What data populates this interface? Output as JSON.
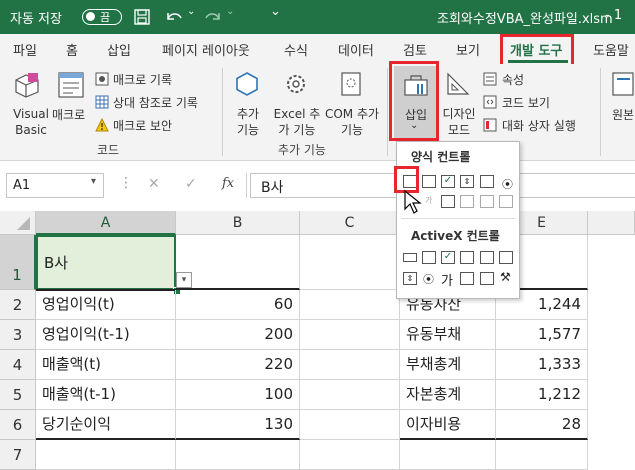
{
  "titlebar": {
    "autosave_label": "자동 저장",
    "toggle_state": "끔",
    "filename": "조회와수정VBA_완성파일.xlsm",
    "suffix": "- 1"
  },
  "tabs": [
    "파일",
    "홈",
    "삽입",
    "페이지 레이아웃",
    "수식",
    "데이터",
    "검토",
    "보기",
    "개발 도구",
    "도움말"
  ],
  "ribbon": {
    "code": {
      "visual_basic": "Visual Basic",
      "macro": "매크로",
      "record_macro": "매크로 기록",
      "relative_ref": "상대 참조로 기록",
      "macro_security": "매크로 보안",
      "group_label": "코드"
    },
    "addins": {
      "addins": "추가 기능",
      "excel_addins": "Excel 추가 기능",
      "com_addins": "COM 추가 기능",
      "group_label": "추가 기능"
    },
    "controls": {
      "insert": "삽입",
      "design_mode": "디자인 모드",
      "properties": "속성",
      "view_code": "코드 보기",
      "run_dialog": "대화 상자 실행"
    },
    "xml": {
      "source": "원본"
    }
  },
  "formula_bar": {
    "name_box": "A1",
    "fx": "fx",
    "value": "B사"
  },
  "columns": [
    "A",
    "B",
    "C",
    "D",
    "E"
  ],
  "rows": [
    {
      "num": "1",
      "a": "B사",
      "b": "",
      "d": "",
      "e": ""
    },
    {
      "num": "2",
      "a": "영업이익(t)",
      "b": "60",
      "d": "유동자산",
      "e": "1,244"
    },
    {
      "num": "3",
      "a": "영업이익(t-1)",
      "b": "200",
      "d": "유동부채",
      "e": "1,577"
    },
    {
      "num": "4",
      "a": "매출액(t)",
      "b": "220",
      "d": "부채총계",
      "e": "1,333"
    },
    {
      "num": "5",
      "a": "매출액(t-1)",
      "b": "100",
      "d": "자본총계",
      "e": "1,212"
    },
    {
      "num": "6",
      "a": "당기순이익",
      "b": "130",
      "d": "이자비용",
      "e": "28"
    },
    {
      "num": "7",
      "a": "",
      "b": "",
      "d": "",
      "e": ""
    }
  ],
  "insert_panel": {
    "form_controls": "양식 컨트롤",
    "activex_controls": "ActiveX 컨트롤",
    "ga": "가"
  },
  "colors": {
    "excel_green": "#217346",
    "highlight_red": "#e8262e",
    "selected_cell": "#e2efda"
  }
}
